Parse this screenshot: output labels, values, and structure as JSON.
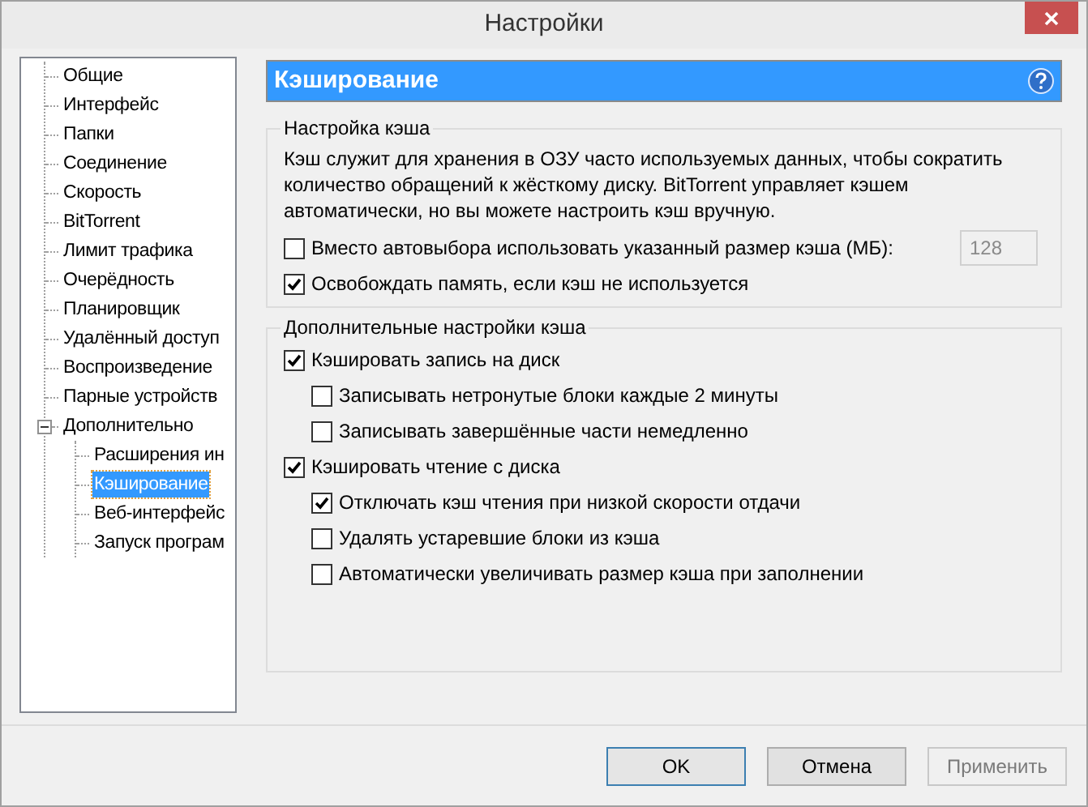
{
  "window": {
    "title": "Настройки"
  },
  "tree": [
    {
      "label": "Общие",
      "selected": false
    },
    {
      "label": "Интерфейс",
      "selected": false
    },
    {
      "label": "Папки",
      "selected": false
    },
    {
      "label": "Соединение",
      "selected": false
    },
    {
      "label": "Скорость",
      "selected": false
    },
    {
      "label": "BitTorrent",
      "selected": false
    },
    {
      "label": "Лимит трафика",
      "selected": false
    },
    {
      "label": "Очерёдность",
      "selected": false
    },
    {
      "label": "Планировщик",
      "selected": false
    },
    {
      "label": "Удалённый доступ",
      "selected": false
    },
    {
      "label": "Воспроизведение",
      "selected": false
    },
    {
      "label": "Парные устройств",
      "selected": false
    },
    {
      "label": "Дополнительно",
      "selected": false,
      "expanded": true,
      "children": [
        {
          "label": "Расширения ин",
          "selected": false
        },
        {
          "label": "Кэширование",
          "selected": true
        },
        {
          "label": "Веб-интерфейс",
          "selected": false
        },
        {
          "label": "Запуск програм",
          "selected": false
        }
      ]
    }
  ],
  "page": {
    "title": "Кэширование",
    "groups": [
      {
        "title": "Настройка кэша",
        "description": "Кэш служит для хранения в ОЗУ часто используемых данных, чтобы сократить количество обращений к жёсткому диску. BitTorrent управляет кэшем автоматически, но вы можете настроить кэш вручную.",
        "options": [
          {
            "label": "Вместо автовыбора использовать указанный размер кэша (МБ):",
            "checked": false,
            "field": {
              "value": "128",
              "disabled": true
            }
          },
          {
            "label": "Освобождать память, если кэш не используется",
            "checked": true
          }
        ]
      },
      {
        "title": "Дополнительные настройки кэша",
        "options": [
          {
            "label": "Кэшировать запись на диск",
            "checked": true,
            "children": [
              {
                "label": "Записывать нетронутые блоки каждые 2 минуты",
                "checked": false
              },
              {
                "label": "Записывать завершённые части немедленно",
                "checked": false
              }
            ]
          },
          {
            "label": "Кэшировать чтение с диска",
            "checked": true,
            "children": [
              {
                "label": "Отключать кэш чтения при низкой скорости отдачи",
                "checked": true
              },
              {
                "label": "Удалять устаревшие блоки из кэша",
                "checked": false
              },
              {
                "label": "Автоматически увеличивать размер кэша при заполнении",
                "checked": false
              }
            ]
          }
        ]
      }
    ]
  },
  "buttons": [
    {
      "label": "OK",
      "kind": "default",
      "disabled": false
    },
    {
      "label": "Отмена",
      "kind": "normal",
      "disabled": false
    },
    {
      "label": "Применить",
      "kind": "normal",
      "disabled": true
    }
  ]
}
